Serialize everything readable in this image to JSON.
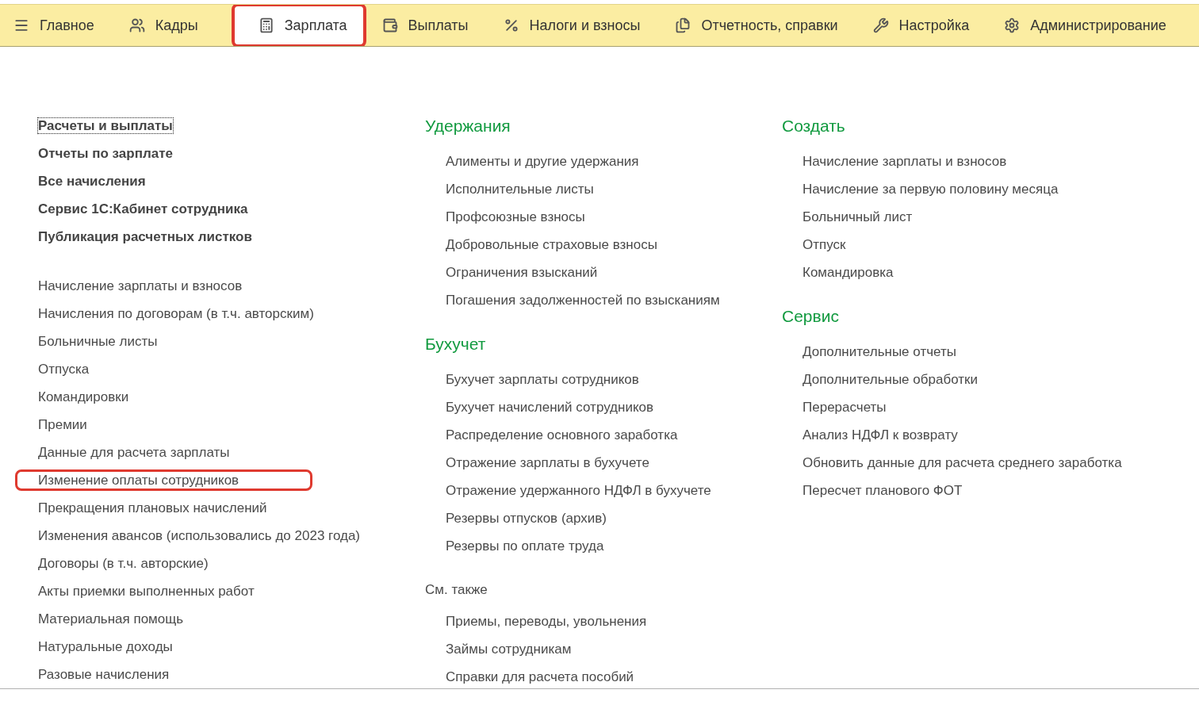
{
  "tabs": [
    {
      "label": "Главное",
      "selected": false,
      "highlighted": false
    },
    {
      "label": "Кадры",
      "selected": false,
      "highlighted": false
    },
    {
      "label": "Зарплата",
      "selected": true,
      "highlighted": true
    },
    {
      "label": "Выплаты",
      "selected": false,
      "highlighted": false
    },
    {
      "label": "Налоги и взносы",
      "selected": false,
      "highlighted": false
    },
    {
      "label": "Отчетность, справки",
      "selected": false,
      "highlighted": false
    },
    {
      "label": "Настройка",
      "selected": false,
      "highlighted": false
    },
    {
      "label": "Администрирование",
      "selected": false,
      "highlighted": false
    }
  ],
  "left_column": {
    "main_links": [
      {
        "label": "Расчеты и выплаты",
        "focused": true
      },
      {
        "label": "Отчеты по зарплате",
        "focused": false
      },
      {
        "label": "Все начисления",
        "focused": false
      },
      {
        "label": "Сервис 1С:Кабинет сотрудника",
        "focused": false
      },
      {
        "label": "Публикация расчетных листков",
        "focused": false
      }
    ],
    "items": [
      {
        "label": "Начисление зарплаты и взносов",
        "highlighted": false
      },
      {
        "label": "Начисления по договорам (в т.ч. авторским)",
        "highlighted": false
      },
      {
        "label": "Больничные листы",
        "highlighted": false
      },
      {
        "label": "Отпуска",
        "highlighted": false
      },
      {
        "label": "Командировки",
        "highlighted": false
      },
      {
        "label": "Премии",
        "highlighted": false
      },
      {
        "label": "Данные для расчета зарплаты",
        "highlighted": false
      },
      {
        "label": "Изменение оплаты сотрудников",
        "highlighted": true
      },
      {
        "label": "Прекращения плановых начислений",
        "highlighted": false
      },
      {
        "label": "Изменения авансов (использовались до 2023 года)",
        "highlighted": false
      },
      {
        "label": "Договоры (в т.ч. авторские)",
        "highlighted": false
      },
      {
        "label": "Акты приемки выполненных работ",
        "highlighted": false
      },
      {
        "label": "Материальная помощь",
        "highlighted": false
      },
      {
        "label": "Натуральные доходы",
        "highlighted": false
      },
      {
        "label": "Разовые начисления",
        "highlighted": false
      }
    ]
  },
  "middle_column": [
    {
      "kind": "group",
      "title": "Удержания",
      "items": [
        "Алименты и другие удержания",
        "Исполнительные листы",
        "Профсоюзные взносы",
        "Добровольные страховые взносы",
        "Ограничения взысканий",
        "Погашения задолженностей по взысканиям"
      ]
    },
    {
      "kind": "group",
      "title": "Бухучет",
      "items": [
        "Бухучет зарплаты сотрудников",
        "Бухучет начислений сотрудников",
        "Распределение основного заработка",
        "Отражение зарплаты в бухучете",
        "Отражение удержанного НДФЛ в бухучете",
        "Резервы отпусков (архив)",
        "Резервы по оплате труда"
      ]
    },
    {
      "kind": "see_also",
      "title": "См. также",
      "items": [
        "Приемы, переводы, увольнения",
        "Займы сотрудникам",
        "Справки для расчета пособий"
      ]
    }
  ],
  "right_column": [
    {
      "kind": "group",
      "title": "Создать",
      "items": [
        "Начисление зарплаты и взносов",
        "Начисление за первую половину месяца",
        "Больничный лист",
        "Отпуск",
        "Командировка"
      ]
    },
    {
      "kind": "group",
      "title": "Сервис",
      "items": [
        "Дополнительные отчеты",
        "Дополнительные обработки",
        "Перерасчеты",
        "Анализ НДФЛ к возврату",
        "Обновить данные для расчета среднего заработка",
        "Пересчет планового ФОТ"
      ]
    }
  ]
}
